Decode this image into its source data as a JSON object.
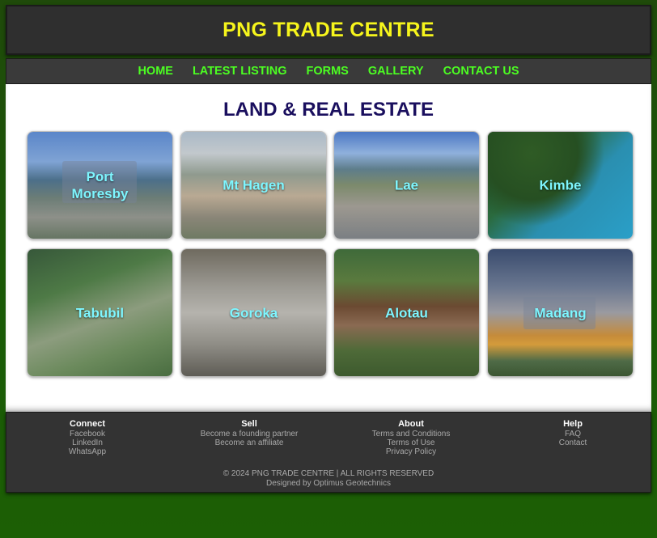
{
  "site": {
    "title": "PNG TRADE CENTRE"
  },
  "nav": [
    {
      "label": "HOME"
    },
    {
      "label": "LATEST LISTING"
    },
    {
      "label": "FORMS"
    },
    {
      "label": "GALLERY"
    },
    {
      "label": "CONTACT US"
    }
  ],
  "page": {
    "title": "LAND & REAL ESTATE"
  },
  "cities": [
    {
      "label": "Port Moresby"
    },
    {
      "label": "Mt Hagen"
    },
    {
      "label": "Lae"
    },
    {
      "label": "Kimbe"
    },
    {
      "label": "Tabubil"
    },
    {
      "label": "Goroka"
    },
    {
      "label": "Alotau"
    },
    {
      "label": "Madang"
    }
  ],
  "footer": {
    "columns": [
      {
        "heading": "Connect",
        "links": [
          "Facebook",
          "LinkedIn",
          "WhatsApp"
        ]
      },
      {
        "heading": "Sell",
        "links": [
          "Become a founding partner",
          "Become an affiliate"
        ]
      },
      {
        "heading": "About",
        "links": [
          "Terms and Conditions",
          "Terms of Use",
          "Privacy Policy"
        ]
      },
      {
        "heading": "Help",
        "links": [
          "FAQ",
          "Contact"
        ]
      }
    ],
    "copyright": "© 2024 PNG TRADE CENTRE | ALL RIGHTS RESERVED",
    "credit": "Designed by Optimus Geotechnics"
  }
}
